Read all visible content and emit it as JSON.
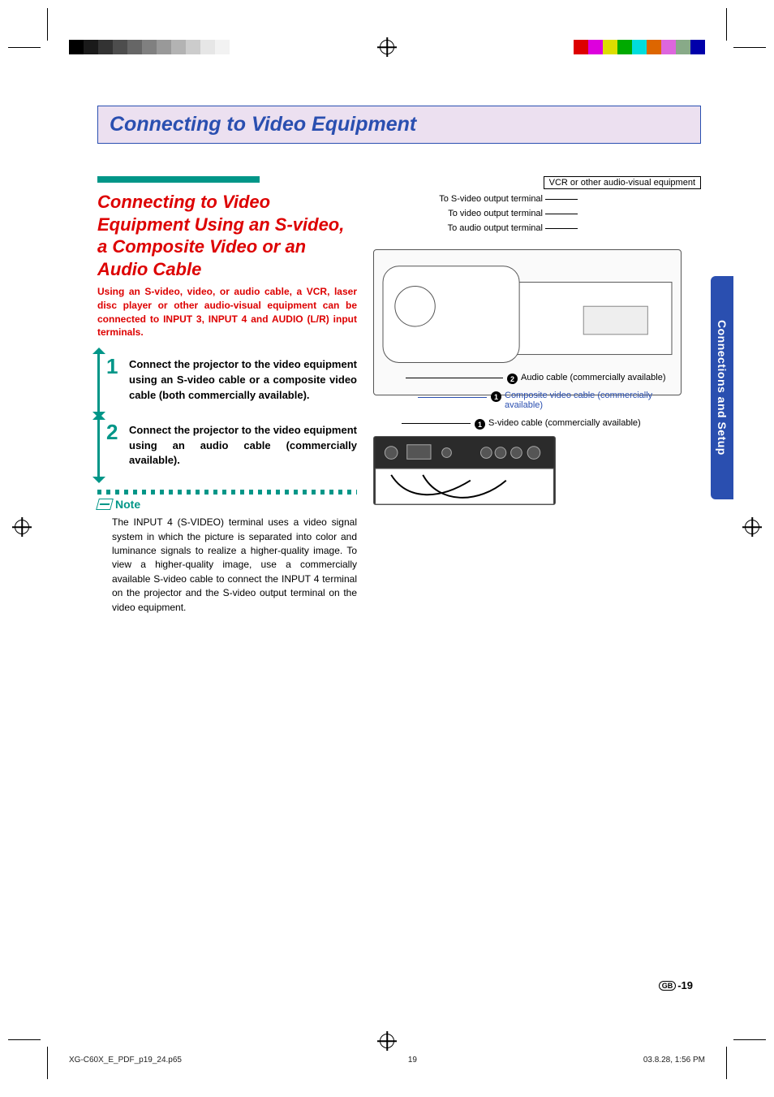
{
  "side_tab": "Connections and Setup",
  "title": "Connecting to Video Equipment",
  "subtitle": "Connecting to Video Equipment Using an S-video, a Composite Video or an Audio Cable",
  "intro": "Using an S-video, video, or audio cable, a VCR, laser disc player or other audio-visual equipment can be connected to INPUT 3, INPUT 4 and AUDIO (L/R) input terminals.",
  "steps": [
    {
      "num": "1",
      "text": "Connect the projector to the video equipment using an S-video cable or a composite video cable (both commercially available)."
    },
    {
      "num": "2",
      "text": "Connect the projector to the video equipment using an audio cable (commercially available)."
    }
  ],
  "note_label": "Note",
  "note_body": "The INPUT 4 (S-VIDEO) terminal uses a video signal system in which the picture is separated into color and luminance signals to realize a higher-quality image. To view a higher-quality image, use a commercially available S-video cable to connect the INPUT 4 terminal on the projector and the S-video output terminal on the video equipment.",
  "diagram": {
    "equip_box": "VCR or other audio-visual equipment",
    "terminals": [
      "To S-video output terminal",
      "To video output terminal",
      "To audio output terminal"
    ],
    "callouts": [
      {
        "num": "2",
        "text": "Audio cable (commercially available)",
        "color": "black"
      },
      {
        "num": "1",
        "text": "Composite video cable (commercially available)",
        "color": "blue"
      },
      {
        "num": "1",
        "text": "S-video cable (commercially available)",
        "color": "black"
      }
    ]
  },
  "footer": {
    "region": "GB",
    "page": "-19",
    "file": "XG-C60X_E_PDF_p19_24.p65",
    "sheet": "19",
    "datetime": "03.8.28, 1:56 PM"
  }
}
